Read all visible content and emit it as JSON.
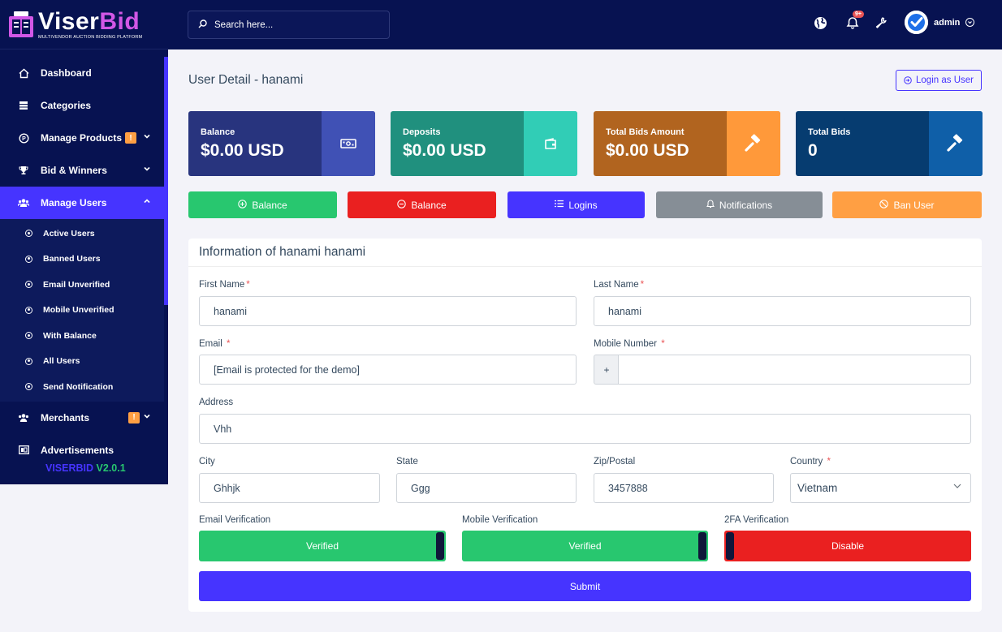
{
  "brand": {
    "name_part1": "Viser",
    "name_part2": "Bid",
    "tagline": "MULTIVENDOR AUCTION BIDDING PLATFORM",
    "version_name": "VISERBID",
    "version_num": "V2.0.1"
  },
  "sidebar": {
    "items": [
      {
        "label": "Dashboard"
      },
      {
        "label": "Categories"
      },
      {
        "label": "Manage Products",
        "badge": "!"
      },
      {
        "label": "Bid & Winners"
      },
      {
        "label": "Manage Users"
      },
      {
        "label": "Merchants",
        "badge": "!"
      },
      {
        "label": "Advertisements"
      }
    ],
    "submenu": [
      {
        "label": "Active Users"
      },
      {
        "label": "Banned Users"
      },
      {
        "label": "Email Unverified"
      },
      {
        "label": "Mobile Unverified"
      },
      {
        "label": "With Balance"
      },
      {
        "label": "All Users"
      },
      {
        "label": "Send Notification"
      }
    ]
  },
  "topbar": {
    "search_placeholder": "Search here...",
    "notification_badge": "9+",
    "user_name": "admin"
  },
  "page": {
    "title": "User Detail - hanami",
    "login_as_label": "Login as User"
  },
  "stats": [
    {
      "label": "Balance",
      "value": "$0.00 USD",
      "color": "#28347e",
      "icon_bg": "#4051b5"
    },
    {
      "label": "Deposits",
      "value": "$0.00 USD",
      "color": "#20907e",
      "icon_bg": "#31cdb6"
    },
    {
      "label": "Total Bids Amount",
      "value": "$0.00 USD",
      "color": "#b1641f",
      "icon_bg": "#ff993a"
    },
    {
      "label": "Total Bids",
      "value": "0",
      "color": "#063c70",
      "icon_bg": "#0f5fa8"
    }
  ],
  "actions": [
    {
      "label": "Balance",
      "icon": "plus-circle",
      "color": "#28c76f"
    },
    {
      "label": "Balance",
      "icon": "minus-circle",
      "color": "#ea2020"
    },
    {
      "label": "Logins",
      "icon": "list",
      "color": "#4634ff"
    },
    {
      "label": "Notifications",
      "icon": "bell",
      "color": "#868e96"
    },
    {
      "label": "Ban User",
      "icon": "ban",
      "color": "#ff9f43"
    }
  ],
  "form": {
    "title": "Information of hanami hanami",
    "first_name_label": "First Name",
    "first_name": "hanami",
    "last_name_label": "Last Name",
    "last_name": "hanami",
    "email_label": "Email",
    "email": "[Email is protected for the demo]",
    "mobile_label": "Mobile Number",
    "mobile_prefix": "+",
    "mobile": "",
    "address_label": "Address",
    "address": "Vhh",
    "city_label": "City",
    "city": "Ghhjk",
    "state_label": "State",
    "state": "Ggg",
    "zip_label": "Zip/Postal",
    "zip": "3457888",
    "country_label": "Country",
    "country": "Vietnam",
    "email_verification_label": "Email Verification",
    "email_verification": "Verified",
    "mobile_verification_label": "Mobile Verification",
    "mobile_verification": "Verified",
    "twofa_label": "2FA Verification",
    "twofa": "Disable",
    "submit_label": "Submit",
    "required_mark": "*"
  }
}
